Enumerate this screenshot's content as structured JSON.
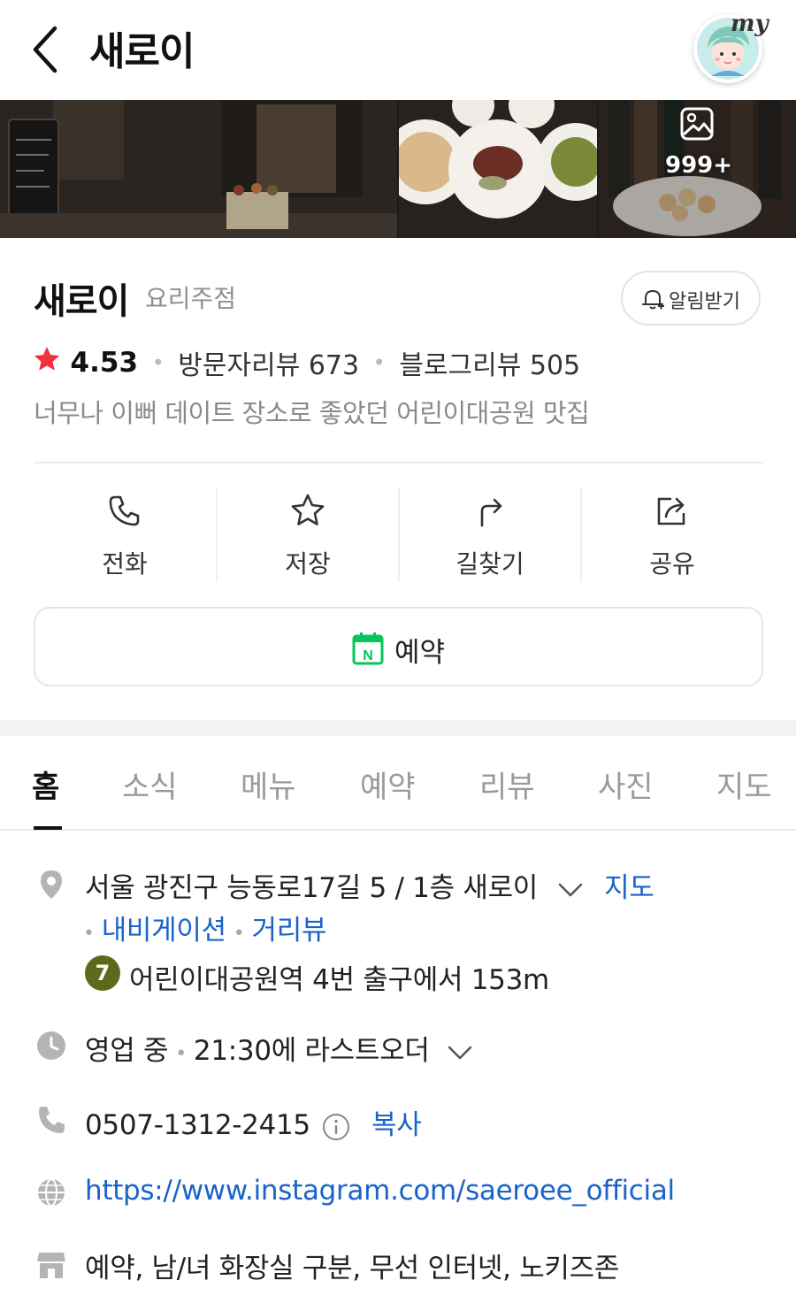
{
  "header": {
    "title": "새로이",
    "my_label": "my"
  },
  "photos": {
    "count": "999+"
  },
  "place": {
    "name": "새로이",
    "category": "요리주점",
    "alert_label": "알림받기",
    "rating": "4.53",
    "visitor_reviews": "방문자리뷰 673",
    "blog_reviews": "블로그리뷰 505",
    "tagline": "너무나 이뻐 데이트 장소로 좋았던 어린이대공원 맛집"
  },
  "actions": [
    {
      "label": "전화",
      "icon": "phone-icon"
    },
    {
      "label": "저장",
      "icon": "star-icon"
    },
    {
      "label": "길찾기",
      "icon": "directions-icon"
    },
    {
      "label": "공유",
      "icon": "share-icon"
    }
  ],
  "reserve": {
    "label": "예약",
    "badge": "N"
  },
  "tabs": [
    "홈",
    "소식",
    "메뉴",
    "예약",
    "리뷰",
    "사진",
    "지도"
  ],
  "info": {
    "address": "서울 광진구 능동로17길 5 / 1층 새로이",
    "map_link": "지도",
    "navigation_link": "내비게이션",
    "street_view_link": "거리뷰",
    "subway_line": "7",
    "subway_text": "어린이대공원역 4번 출구에서 153m",
    "hours_status": "영업 중",
    "hours_detail": "21:30에 라스트오더",
    "phone": "0507-1312-2415",
    "copy_label": "복사",
    "website": "https://www.instagram.com/saeroee_official",
    "amenities": "예약, 남/녀 화장실 구분, 무선 인터넷, 노키즈존"
  },
  "colors": {
    "star": "#f0323c",
    "link": "#1a63c9",
    "naver_green": "#03c75a",
    "subway_line7": "#5c6a1c"
  }
}
